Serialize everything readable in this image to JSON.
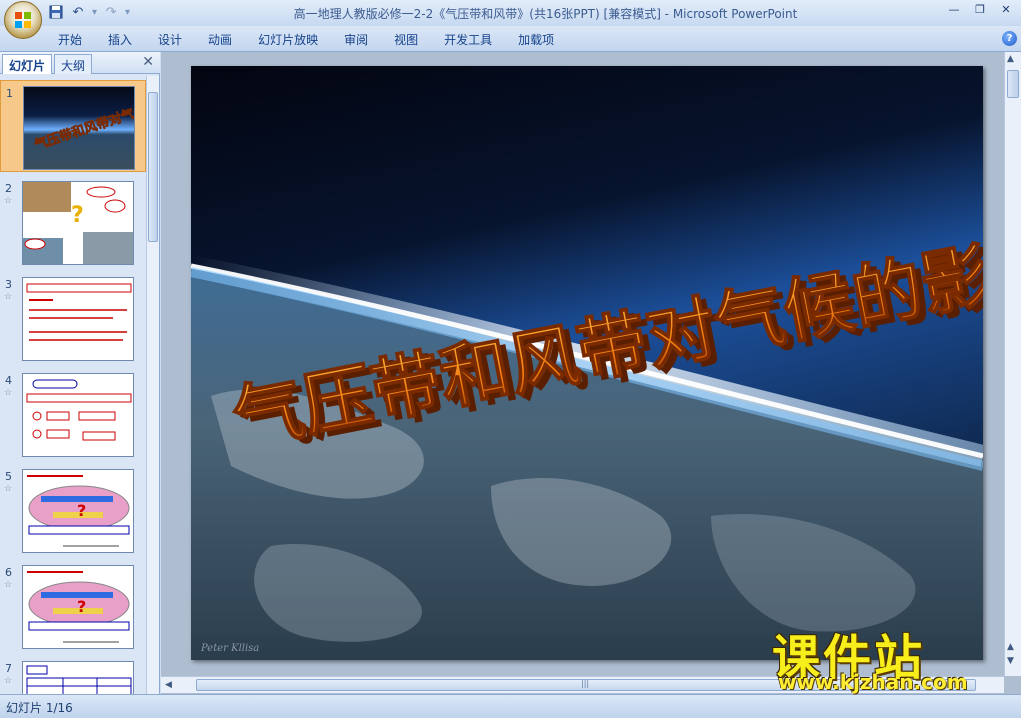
{
  "window": {
    "title": "高一地理人教版必修一2-2《气压带和风带》(共16张PPT) [兼容模式] - Microsoft PowerPoint"
  },
  "ribbon": {
    "tabs": [
      "开始",
      "插入",
      "设计",
      "动画",
      "幻灯片放映",
      "审阅",
      "视图",
      "开发工具",
      "加载项"
    ]
  },
  "panel": {
    "tab_slides": "幻灯片",
    "tab_outline": "大纲",
    "slide_numbers": [
      "1",
      "2",
      "3",
      "4",
      "5",
      "6",
      "7"
    ],
    "selected_slide": 1
  },
  "slide": {
    "title": "气压带和风带对气候的影响",
    "signature": "Peter Kllisa"
  },
  "status": {
    "text": "幻灯片 1/16"
  },
  "watermark": {
    "main": "课件站",
    "url": "www.kjzhan.com"
  },
  "colors": {
    "selected_thumb": "#f6c98a",
    "title_orange": "#f07a10",
    "watermark_yellow": "#f7ee1c"
  }
}
